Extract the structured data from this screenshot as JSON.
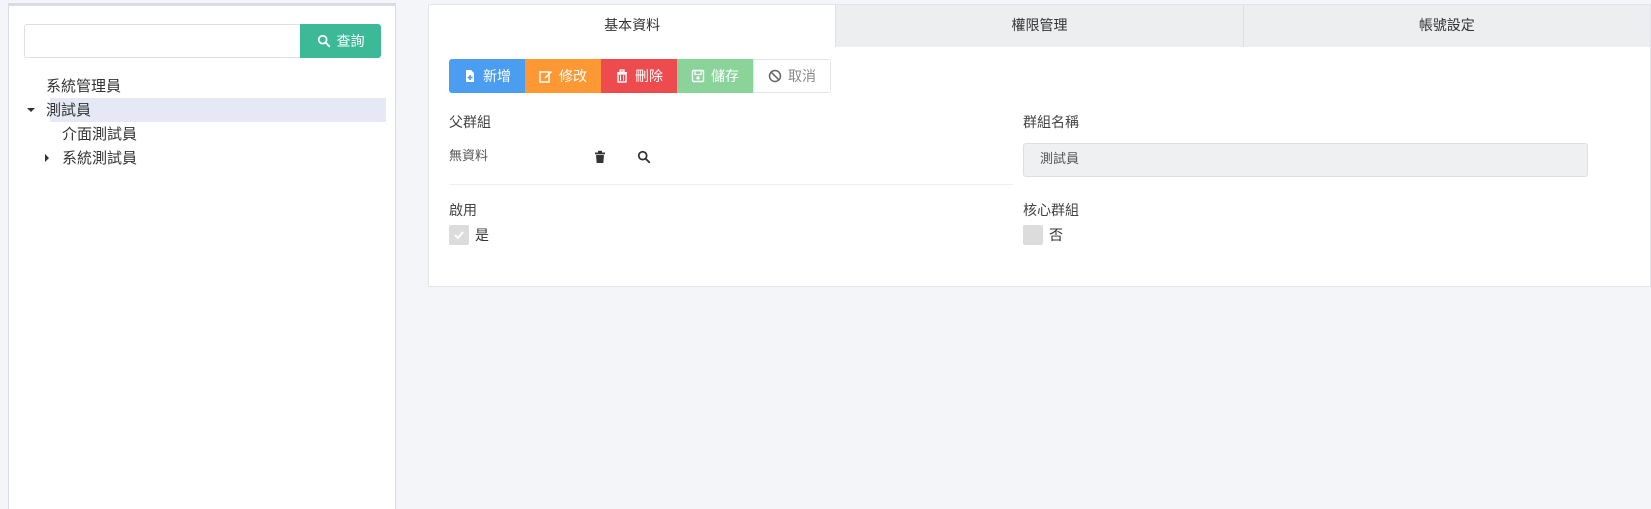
{
  "search": {
    "placeholder": "",
    "button_label": "查詢"
  },
  "tree": {
    "nodes": [
      {
        "label": "系統管理員"
      },
      {
        "label": "測試員"
      },
      {
        "label": "介面測試員"
      },
      {
        "label": "系統測試員"
      }
    ]
  },
  "tabs": [
    {
      "label": "基本資料"
    },
    {
      "label": "權限管理"
    },
    {
      "label": "帳號設定"
    }
  ],
  "toolbar": {
    "add_label": "新增",
    "edit_label": "修改",
    "delete_label": "刪除",
    "save_label": "儲存",
    "cancel_label": "取消"
  },
  "form": {
    "parent_group_label": "父群組",
    "parent_group_value": "無資料",
    "group_name_label": "群組名稱",
    "group_name_value": "測試員",
    "enabled_label": "啟用",
    "enabled_value": "是",
    "core_group_label": "核心群組",
    "core_group_value": "否"
  },
  "colors": {
    "search_button": "#3cba98",
    "add": "#4a9df0",
    "edit": "#fd9834",
    "delete": "#ee4b4e",
    "save": "#8ad49a",
    "tree_selected": "#e6e9f5"
  }
}
